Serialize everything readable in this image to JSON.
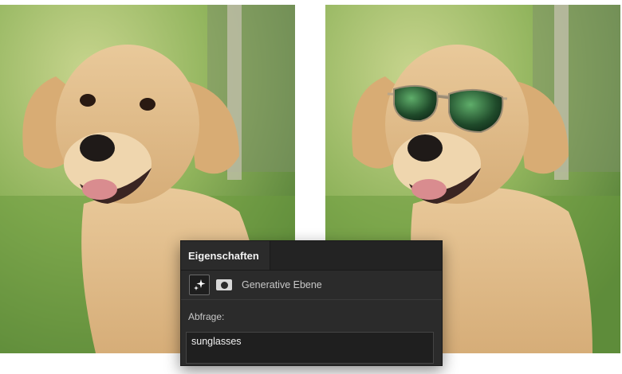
{
  "images": {
    "original_alt": "golden-retriever-puppy-original",
    "edited_alt": "golden-retriever-puppy-with-sunglasses"
  },
  "panel": {
    "tab_label": "Eigenschaften",
    "layer_type_label": "Generative Ebene",
    "query_label": "Abfrage:",
    "prompt_value": "sunglasses"
  },
  "icons": {
    "generative": "sparkle-icon",
    "mask": "mask-icon"
  }
}
